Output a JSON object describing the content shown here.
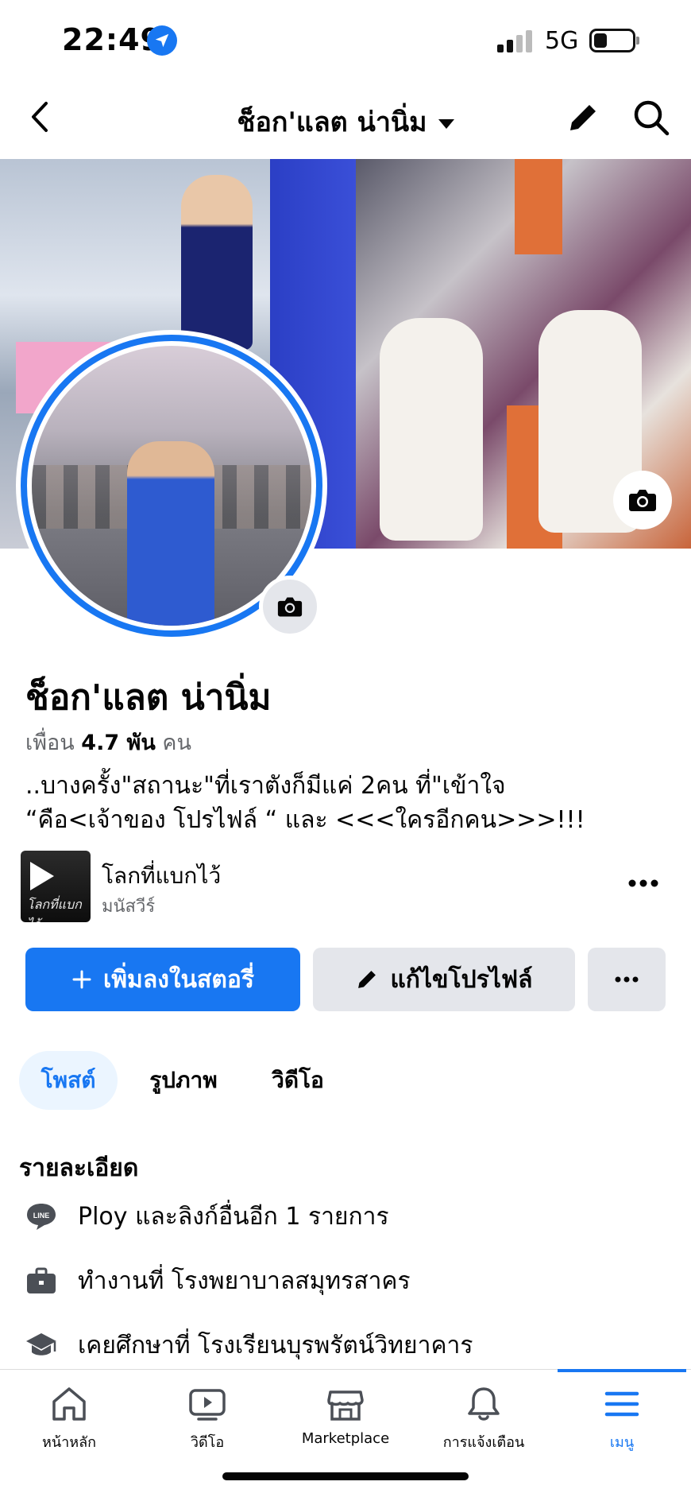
{
  "status": {
    "time": "22:49",
    "network": "5G"
  },
  "nav": {
    "title": "ช็อก'แลต น่านิ่ม"
  },
  "profile": {
    "name": "ช็อก'แลต น่านิ่ม",
    "friends_label": "เพื่อน",
    "friends_count": "4.7 พัน",
    "friends_unit": "คน",
    "bio_line1": "..บางครั้ง\"สถานะ\"ที่เราตังก็มีแค่ 2คน ที่\"เข้าใจ",
    "bio_line2": "“คือ<เจ้าของ โปรไฟล์ “ และ <<<ใครอีกคน>>>!!!"
  },
  "music": {
    "title": "โลกที่แบกไว้",
    "artist": "มนัสวีร์",
    "art_text": "โลกที่แบกไว้"
  },
  "actions": {
    "add_story": "เพิ่มลงในสตอรี่",
    "edit_profile": "แก้ไขโปรไฟล์"
  },
  "tabs": [
    {
      "label": "โพสต์"
    },
    {
      "label": "รูปภาพ"
    },
    {
      "label": "วิดีโอ"
    }
  ],
  "details": {
    "heading": "รายละเอียด",
    "items": [
      {
        "icon": "line-icon",
        "text": "Ploy และลิงก์อื่นอีก 1 รายการ"
      },
      {
        "icon": "briefcase-icon",
        "text": "ทำงานที่ โรงพยาบาลสมุทรสาคร"
      },
      {
        "icon": "graduation-cap-icon",
        "text": "เคยศึกษาที่ โรงเรียนบุรพรัตน์วิทยาคาร"
      }
    ]
  },
  "bottom_nav": [
    {
      "label": "หน้าหลัก",
      "icon": "home-icon"
    },
    {
      "label": "วิดีโอ",
      "icon": "video-icon"
    },
    {
      "label": "Marketplace",
      "icon": "marketplace-icon"
    },
    {
      "label": "การแจ้งเตือน",
      "icon": "bell-icon"
    },
    {
      "label": "เมนู",
      "icon": "menu-icon"
    }
  ],
  "colors": {
    "accent": "#1877f2",
    "button_gray": "#e4e6eb",
    "secondary_text": "#65676b",
    "tab_active_bg": "#ebf5ff"
  }
}
